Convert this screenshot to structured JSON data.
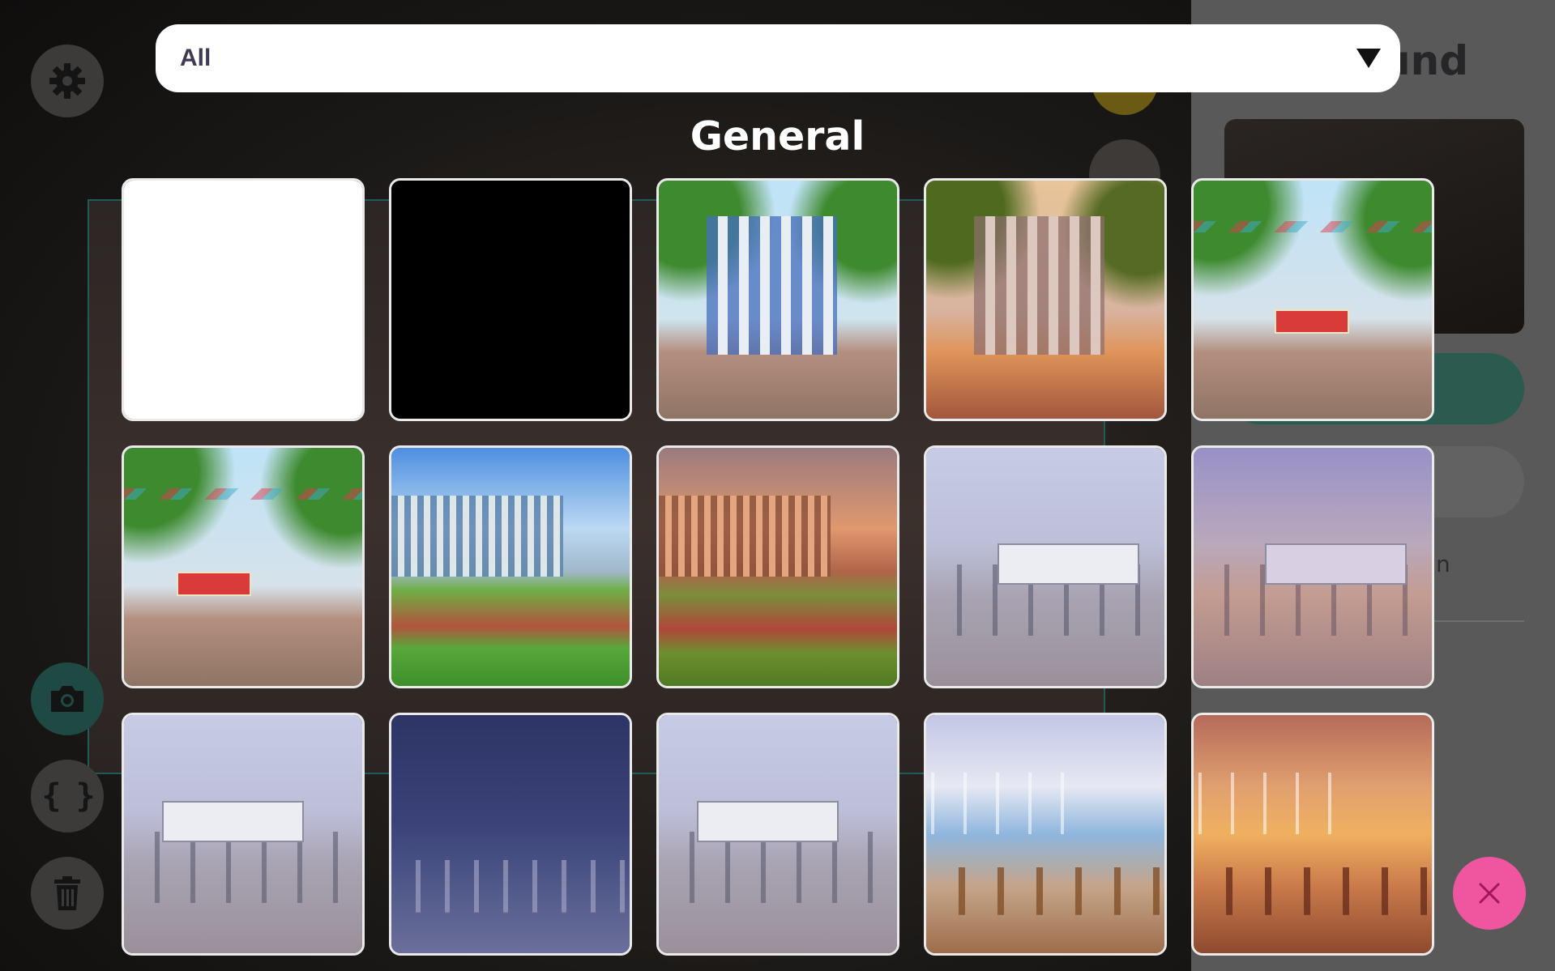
{
  "filter": {
    "selected": "All"
  },
  "section": {
    "title": "General"
  },
  "background_panel": {
    "title_fragment": "und",
    "text_fragment": "n"
  },
  "toolbar": {
    "settings_icon": "gear-icon",
    "screenshot_icon": "camera-icon",
    "code_icon": "braces-icon",
    "delete_icon": "trash-icon",
    "code_glyph": "{ }"
  },
  "close_icon": "close-icon",
  "colors": {
    "accent_pink": "#f0559f",
    "accent_green": "#1f4a43",
    "selector_text": "#3f3a52"
  },
  "backgrounds": [
    {
      "scene": "white"
    },
    {
      "scene": "black"
    },
    {
      "scene": "school-entrance-day"
    },
    {
      "scene": "school-entrance-sunset"
    },
    {
      "scene": "school-festival-day"
    },
    {
      "scene": "school-festival-gate"
    },
    {
      "scene": "school-field-day"
    },
    {
      "scene": "school-field-sunset"
    },
    {
      "scene": "classroom-day"
    },
    {
      "scene": "classroom-evening"
    },
    {
      "scene": "classroom-front-day"
    },
    {
      "scene": "gym-hall-night"
    },
    {
      "scene": "classroom-front-day-2"
    },
    {
      "scene": "classroom-windows-day"
    },
    {
      "scene": "classroom-windows-sunset"
    }
  ]
}
